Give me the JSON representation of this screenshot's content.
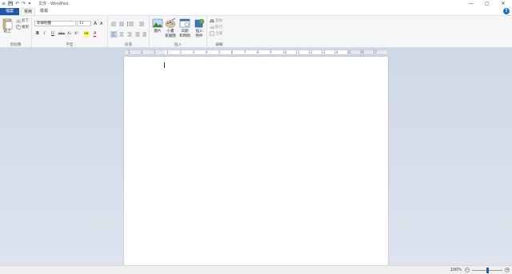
{
  "window": {
    "title": "文件 - WordPad",
    "minimize": "—",
    "maximize": "▢",
    "close": "✕"
  },
  "quick_access": {
    "menu_icon": "≡",
    "save_icon": "💾",
    "undo_icon": "↶",
    "redo_icon": "↷",
    "customize_icon": "▾"
  },
  "tabs": [
    {
      "label": "檔案"
    },
    {
      "label": "常用"
    },
    {
      "label": "檢視"
    }
  ],
  "help": "?",
  "clipboard": {
    "paste": "貼上",
    "cut": "剪下",
    "copy": "複製",
    "label": "剪貼簿"
  },
  "font": {
    "family": "新細明體",
    "size": "11",
    "grow": "A",
    "shrink": "A",
    "bold": "B",
    "italic": "I",
    "underline": "U",
    "strike": "abc",
    "subscript": "X₂",
    "superscript": "X²",
    "highlight": "ab",
    "color": "A",
    "label": "字型"
  },
  "paragraph": {
    "label": "段落"
  },
  "insert": {
    "picture": "圖片",
    "paint_line1": "小畫",
    "paint_line2": "家繪圖",
    "datetime_line1": "日期",
    "datetime_line2": "和時間",
    "object_line1": "插入",
    "object_line2": "物件",
    "label": "插入"
  },
  "editing": {
    "find": "尋找",
    "replace": "取代",
    "select_all": "全選",
    "label": "編輯"
  },
  "ruler": {
    "numbers": [
      "3",
      "2",
      "1",
      "1",
      "2",
      "3",
      "4",
      "5",
      "6",
      "7",
      "8",
      "9",
      "10",
      "11",
      "12",
      "13",
      "14",
      "15",
      "16",
      "17"
    ]
  },
  "status": {
    "zoom": "100%",
    "zoom_out": "−",
    "zoom_in": "+",
    "zoom_level": 1.0
  }
}
